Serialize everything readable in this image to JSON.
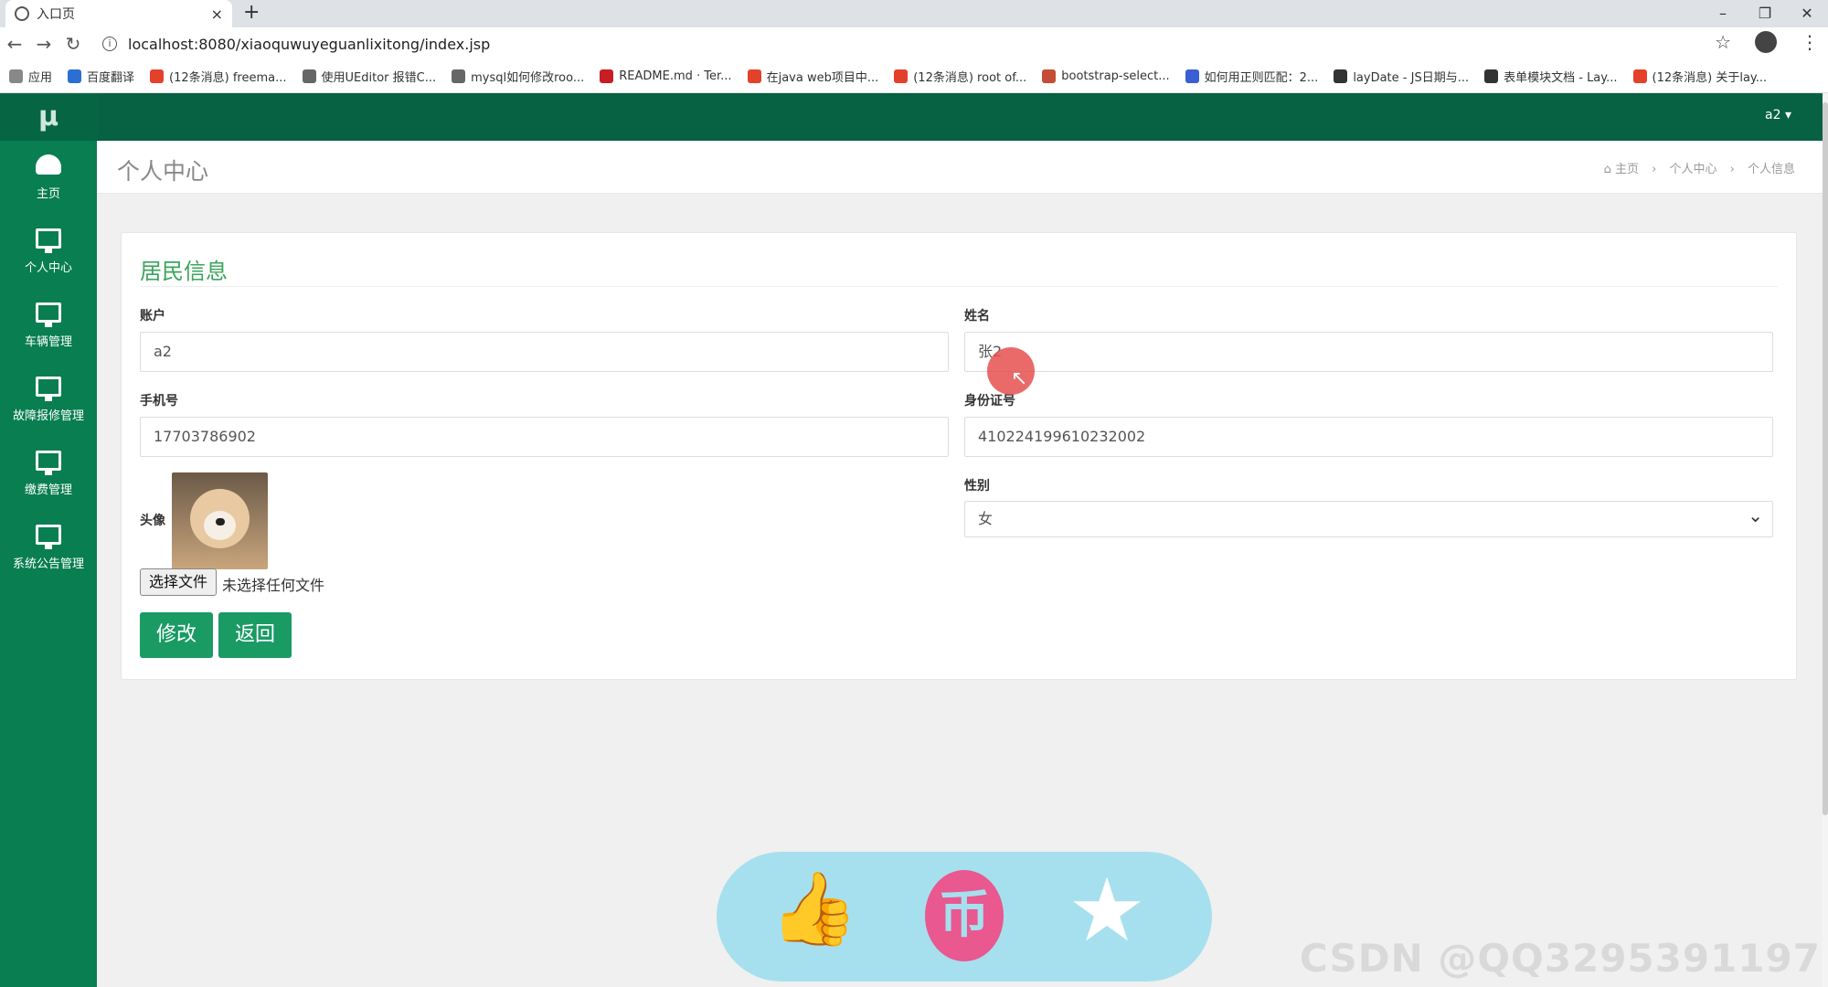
{
  "browser": {
    "tab_title": "入口页",
    "new_tab": "+",
    "close": "×",
    "url": "localhost:8080/xiaoquwuyeguanlixitong/index.jsp",
    "window_controls": [
      "–",
      "❐",
      "✕"
    ],
    "bookmarks": [
      {
        "label": "应用",
        "icon_color": "#888"
      },
      {
        "label": "百度翻译",
        "icon_color": "#2c6fd4"
      },
      {
        "label": "(12条消息) freema...",
        "icon_color": "#e4412b"
      },
      {
        "label": "使用UEditor 报错C...",
        "icon_color": "#666"
      },
      {
        "label": "mysql如何修改roo...",
        "icon_color": "#666"
      },
      {
        "label": "README.md · Ter...",
        "icon_color": "#c71d23"
      },
      {
        "label": "在java web项目中...",
        "icon_color": "#e4412b"
      },
      {
        "label": "(12条消息) root of...",
        "icon_color": "#e4412b"
      },
      {
        "label": "bootstrap-select...",
        "icon_color": "#c34d35"
      },
      {
        "label": "如何用正则匹配：2...",
        "icon_color": "#3860d4"
      },
      {
        "label": "layDate - JS日期与...",
        "icon_color": "#333"
      },
      {
        "label": "表单模块文档 - Lay...",
        "icon_color": "#333"
      },
      {
        "label": "(12条消息) 关于lay...",
        "icon_color": "#e4412b"
      }
    ]
  },
  "sidebar": {
    "logo": "μ",
    "items": [
      {
        "label": "主页",
        "icon": "dashboard-icon"
      },
      {
        "label": "个人中心",
        "icon": "monitor-icon"
      },
      {
        "label": "车辆管理",
        "icon": "monitor-icon"
      },
      {
        "label": "故障报修管理",
        "icon": "monitor-icon"
      },
      {
        "label": "缴费管理",
        "icon": "monitor-icon"
      },
      {
        "label": "系统公告管理",
        "icon": "monitor-icon"
      }
    ]
  },
  "topbar": {
    "user": "a2 ▾"
  },
  "page": {
    "title": "个人中心",
    "breadcrumb": [
      "⌂ 主页",
      "›",
      "个人中心",
      "›",
      "个人信息"
    ]
  },
  "form": {
    "title": "居民信息",
    "account_label": "账户",
    "account_value": "a2",
    "name_label": "姓名",
    "name_value": "张2",
    "phone_label": "手机号",
    "phone_value": "17703786902",
    "id_label": "身份证号",
    "id_value": "410224199610232002",
    "avatar_label": "头像",
    "gender_label": "性别",
    "gender_value": "女",
    "file_button": "选择文件",
    "file_status": "未选择任何文件",
    "submit": "修改",
    "back": "返回"
  },
  "overlay": {
    "coin": "币",
    "thumb": "👍",
    "star": "★"
  },
  "watermark": "CSDN @QQ3295391197",
  "colors": {
    "sidebar": "#087e51",
    "topbar": "#076143",
    "button": "#1a9b64",
    "title": "#3ba55c"
  }
}
